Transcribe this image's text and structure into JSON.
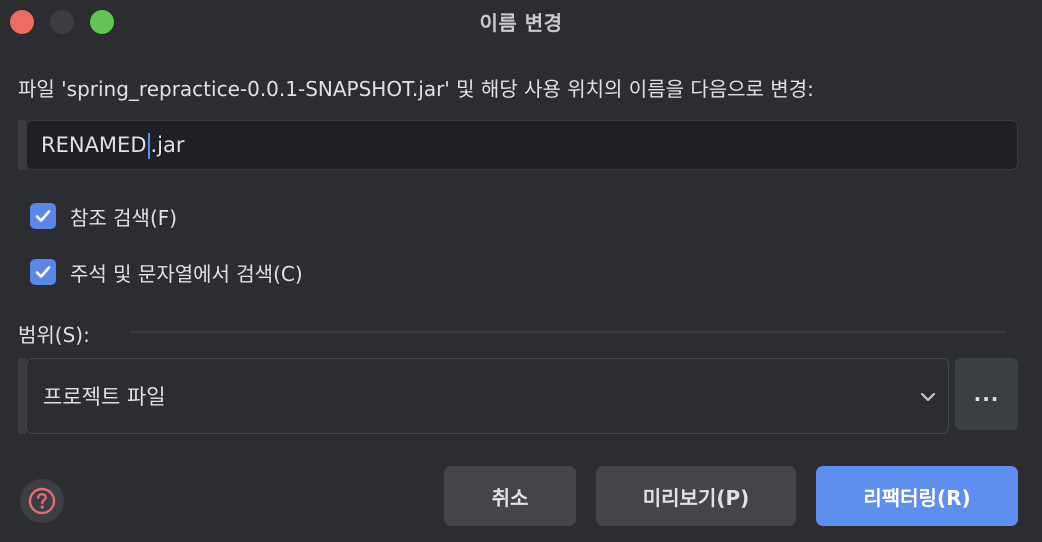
{
  "window": {
    "title": "이름 변경",
    "controls": {
      "close": "close-window-icon",
      "minimize": "minimize-window-icon",
      "maximize": "maximize-window-icon"
    }
  },
  "prompt": "파일 'spring_repractice-0.0.1-SNAPSHOT.jar' 및 해당 사용 위치의 이름을 다음으로 변경:",
  "name_input": {
    "value_before_caret": "RENAMED",
    "value_after_caret": ".jar"
  },
  "options": [
    {
      "label": "참조 검색(F)",
      "checked": true
    },
    {
      "label": "주석 및 문자열에서 검색(C)",
      "checked": true
    }
  ],
  "scope": {
    "label": "범위(S):",
    "selected": "프로젝트 파일",
    "more_label": "..."
  },
  "footer": {
    "help_icon": "help-circle-icon",
    "cancel_label": "취소",
    "preview_label": "미리보기(P)",
    "refactor_label": "리팩터링(R)"
  },
  "colors": {
    "background": "#2b2d30",
    "primary_button": "#5e8ef0",
    "checkbox": "#5a86e8",
    "help_icon": "#e06c75"
  }
}
